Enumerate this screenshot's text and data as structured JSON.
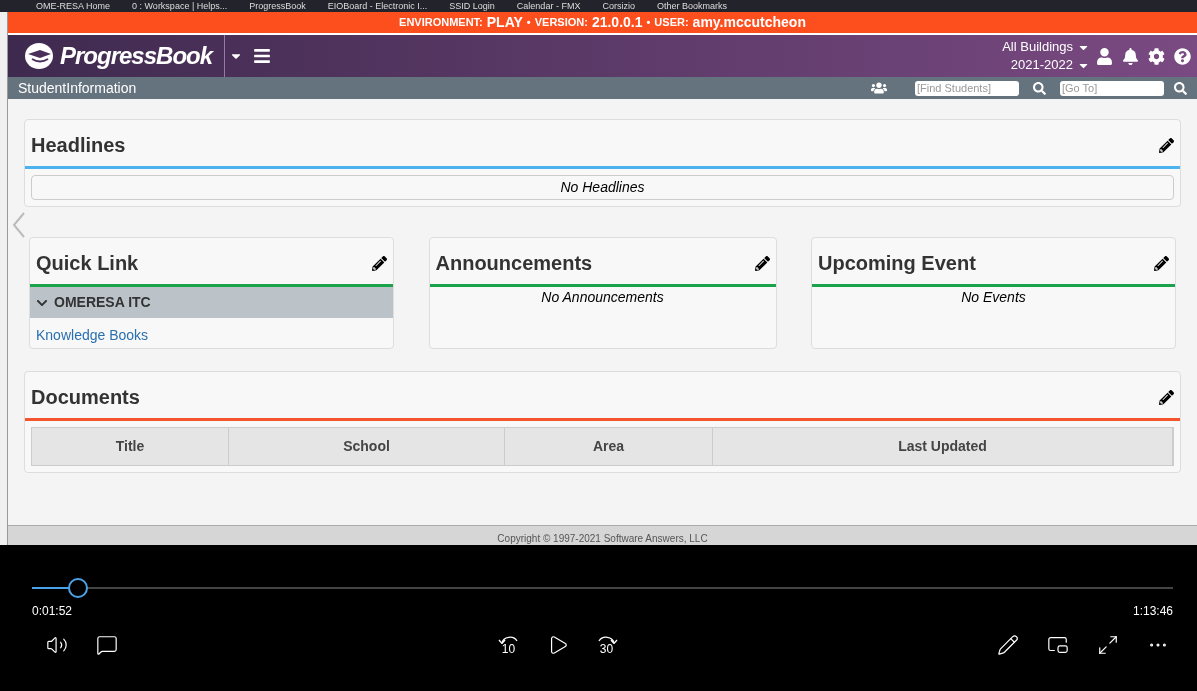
{
  "bookmarks": [
    "OME-RESA Home",
    "0 : Workspace | Helps...",
    "ProgressBook",
    "EIOBoard - Electronic I...",
    "SSID Login",
    "Calendar - FMX",
    "Corsizio",
    "Other Bookmarks"
  ],
  "environment": {
    "separator": "•",
    "env_label": "ENVIRONMENT:",
    "env": "PLAY",
    "version_label": "VERSION:",
    "version": "21.0.0.1",
    "user_label": "USER:",
    "user": "amy.mccutcheon"
  },
  "header": {
    "logo": "ProgressBook",
    "building": "All Buildings",
    "year": "2021-2022"
  },
  "subheader": {
    "title": "StudentInformation",
    "find_placeholder": "[Find Students]",
    "goto_placeholder": "[Go To]"
  },
  "headlines": {
    "title": "Headlines",
    "empty": "No Headlines"
  },
  "widgets": [
    {
      "kind": "links",
      "title": "Quick Link",
      "color": "#1aa34a",
      "group": "OMERESA ITC",
      "expanded": true,
      "links": [
        "Knowledge Books"
      ]
    },
    {
      "kind": "empty",
      "title": "Announcements",
      "color": "#1aa34a",
      "empty": "No Announcements"
    },
    {
      "kind": "empty",
      "title": "Upcoming Event",
      "color": "#1aa34a",
      "empty": "No Events"
    }
  ],
  "documents": {
    "title": "Documents",
    "columns": [
      "Title",
      "School",
      "Area",
      "Last Updated"
    ]
  },
  "footer": "Copyright © 1997-2021 Software Answers, LLC",
  "player": {
    "level": 0.033,
    "elapsed": "0:01:52",
    "total": "1:13:46",
    "back": "10",
    "forward": "30"
  }
}
